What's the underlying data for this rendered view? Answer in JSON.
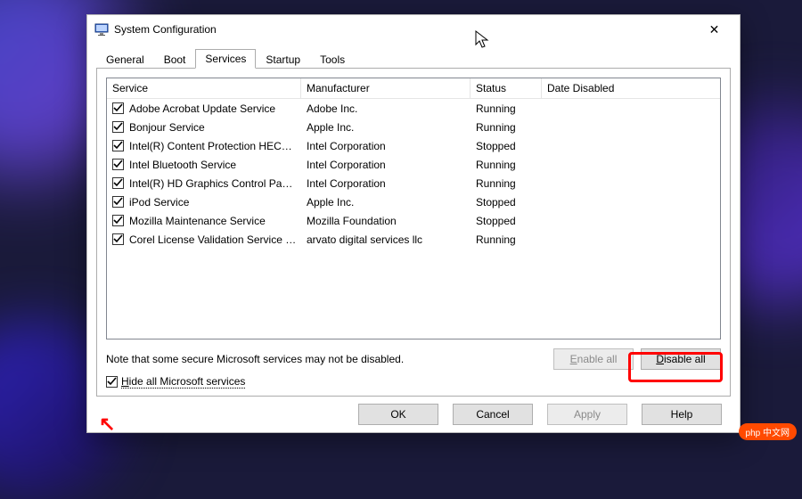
{
  "window": {
    "title": "System Configuration"
  },
  "tabs": {
    "items": [
      "General",
      "Boot",
      "Services",
      "Startup",
      "Tools"
    ],
    "active_index": 2
  },
  "columns": {
    "service": "Service",
    "manufacturer": "Manufacturer",
    "status": "Status",
    "date": "Date Disabled"
  },
  "services": [
    {
      "checked": true,
      "name": "Adobe Acrobat Update Service",
      "manufacturer": "Adobe Inc.",
      "status": "Running",
      "date_disabled": ""
    },
    {
      "checked": true,
      "name": "Bonjour Service",
      "manufacturer": "Apple Inc.",
      "status": "Running",
      "date_disabled": ""
    },
    {
      "checked": true,
      "name": "Intel(R) Content Protection HEC…",
      "manufacturer": "Intel Corporation",
      "status": "Stopped",
      "date_disabled": ""
    },
    {
      "checked": true,
      "name": "Intel Bluetooth Service",
      "manufacturer": "Intel Corporation",
      "status": "Running",
      "date_disabled": ""
    },
    {
      "checked": true,
      "name": "Intel(R) HD Graphics Control Pa…",
      "manufacturer": "Intel Corporation",
      "status": "Running",
      "date_disabled": ""
    },
    {
      "checked": true,
      "name": "iPod Service",
      "manufacturer": "Apple Inc.",
      "status": "Stopped",
      "date_disabled": ""
    },
    {
      "checked": true,
      "name": "Mozilla Maintenance Service",
      "manufacturer": "Mozilla Foundation",
      "status": "Stopped",
      "date_disabled": ""
    },
    {
      "checked": true,
      "name": "Corel License Validation Service …",
      "manufacturer": "arvato digital services llc",
      "status": "Running",
      "date_disabled": ""
    }
  ],
  "note": "Note that some secure Microsoft services may not be disabled.",
  "buttons": {
    "enable_all": "Enable all",
    "enable_all_u": "E",
    "disable_all": "Disable all",
    "disable_all_u": "D",
    "ok": "OK",
    "cancel": "Cancel",
    "apply": "Apply",
    "help": "Help"
  },
  "hide_ms": {
    "checked": true,
    "label_pre": "H",
    "label": "ide all Microsoft services"
  },
  "badge": "php 中文网"
}
